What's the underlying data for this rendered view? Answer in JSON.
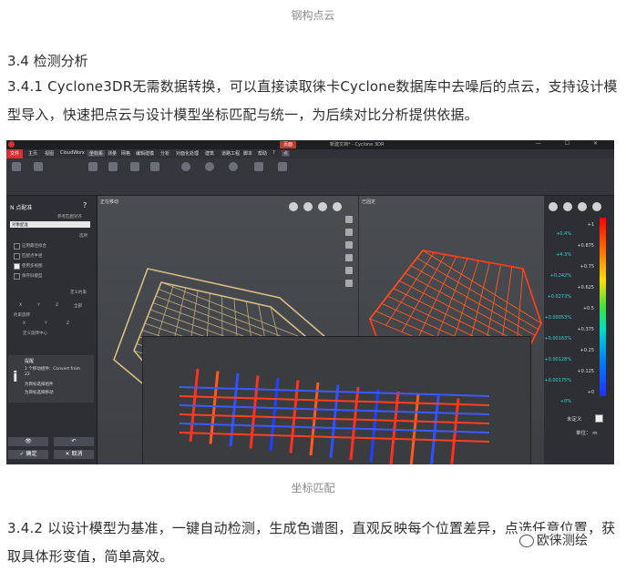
{
  "caption_top": "钢构点云",
  "section_heading": "3.4 检测分析",
  "para1": "3.4.1 Cyclone3DR无需数据转换，可以直接读取徕卡Cyclone数据库中去噪后的点云，支持设计模型导入，快速把点云与设计模型坐标匹配与统一，为后续对比分析提供依据。",
  "caption_mid": "坐标匹配",
  "para2": "3.4.2 以设计模型为基准，一键自动检测，生成色谱图，直观反映每个位置差异，点选任意位置，获取具体形变值，简单高效。",
  "watermark": "欧徕测绘",
  "app": {
    "window_title": "新建文档* - Cyclone 3DR",
    "badge": "页面",
    "menu": [
      "文件",
      "主页",
      "视图",
      "CloudWorx",
      "坐标系",
      "测量",
      "网格",
      "编辑建模",
      "分析",
      "对面化处理",
      "建筑",
      "道路工程",
      "脚本",
      "帮助",
      "?",
      "点"
    ],
    "left_panel": {
      "title": "N 点配准",
      "field1": "参考匹配对齐",
      "select": "对象配准",
      "section1": "选项",
      "options": [
        "应用最佳拟合",
        "匹配点半径",
        "使用多视图",
        "保存旧模型"
      ],
      "section2": "定义约束",
      "constraint_row": [
        "X",
        "Y",
        "Z",
        "全部"
      ],
      "rot_label": "约束旋转",
      "rot_opts": [
        "X",
        "Y",
        "Z"
      ],
      "center_opt": "定义旋转中心",
      "info_title": "提醒",
      "info_lines": [
        "1 个移动组件：Convert from",
        "22",
        "为目标选择组件",
        "为目标选择移动"
      ],
      "ok": "确定",
      "cancel": "取消"
    },
    "view_left_label": "正在移动",
    "view_right_label": "已固定",
    "legend": {
      "values": [
        "+1",
        "+0.875",
        "+0.75",
        "+0.625",
        "+0.5",
        "+0.375",
        "+0.25",
        "+0.125",
        "+0"
      ],
      "labels": [
        "+0.4%",
        "+4.3%",
        "+0.242%",
        "+0.0273%",
        "+0.00053%",
        "+0.00163%",
        "+0.00128%",
        "+0.00175%",
        "+0%"
      ],
      "undef": "未定义",
      "unit": "单位： m"
    }
  }
}
